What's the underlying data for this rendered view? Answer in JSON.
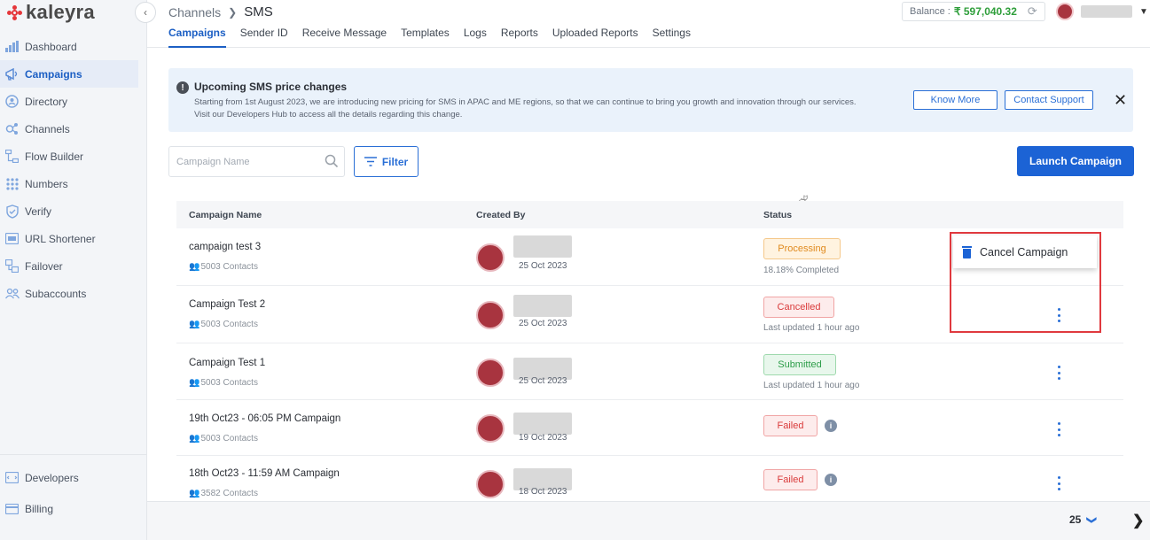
{
  "app": {
    "logo": "kaleyra"
  },
  "sidebar": {
    "items": [
      {
        "label": "Dashboard",
        "icon": "bar-chart-icon"
      },
      {
        "label": "Campaigns",
        "icon": "megaphone-icon",
        "active": true
      },
      {
        "label": "Directory",
        "icon": "contact-icon"
      },
      {
        "label": "Channels",
        "icon": "channels-icon"
      },
      {
        "label": "Flow Builder",
        "icon": "flow-icon"
      },
      {
        "label": "Numbers",
        "icon": "keypad-icon"
      },
      {
        "label": "Verify",
        "icon": "shield-icon"
      },
      {
        "label": "URL Shortener",
        "icon": "link-icon"
      },
      {
        "label": "Failover",
        "icon": "failover-icon"
      },
      {
        "label": "Subaccounts",
        "icon": "users-icon"
      }
    ],
    "bottom": [
      {
        "label": "Developers",
        "icon": "code-icon"
      },
      {
        "label": "Billing",
        "icon": "card-icon"
      }
    ]
  },
  "header": {
    "breadcrumb_parent": "Channels",
    "breadcrumb_current": "SMS",
    "tabs": [
      "Campaigns",
      "Sender ID",
      "Receive Message",
      "Templates",
      "Logs",
      "Reports",
      "Uploaded Reports",
      "Settings"
    ],
    "balance_label": "Balance :",
    "balance_amount": "₹ 597,040.32"
  },
  "banner": {
    "title": "Upcoming SMS price changes",
    "line1": "Starting from 1st August 2023, we are introducing new pricing for SMS in APAC and ME regions, so that we can continue to bring you growth and innovation through our services.",
    "line2": "Visit our Developers Hub to access all the details regarding this change.",
    "know_more": "Know More",
    "contact_support": "Contact Support"
  },
  "toolbar": {
    "search_placeholder": "Campaign Name",
    "filter_label": "Filter",
    "launch_label": "Launch Campaign"
  },
  "table": {
    "headers": {
      "name": "Campaign Name",
      "created_by": "Created By",
      "status": "Status"
    },
    "rows": [
      {
        "name": "campaign test 3",
        "contacts": "5003 Contacts",
        "date": "25 Oct 2023",
        "status": "Processing",
        "sub": "18.18% Completed"
      },
      {
        "name": "Campaign Test 2",
        "contacts": "5003 Contacts",
        "date": "25 Oct 2023",
        "status": "Cancelled",
        "sub": "Last updated 1 hour ago"
      },
      {
        "name": "Campaign Test 1",
        "contacts": "5003 Contacts",
        "date": "25 Oct 2023",
        "status": "Submitted",
        "sub": "Last updated 1 hour ago"
      },
      {
        "name": "19th Oct23 - 06:05 PM Campaign",
        "contacts": "5003 Contacts",
        "date": "19 Oct 2023",
        "status": "Failed",
        "sub": ""
      },
      {
        "name": "18th Oct23 - 11:59 AM Campaign",
        "contacts": "3582 Contacts",
        "date": "18 Oct 2023",
        "status": "Failed",
        "sub": ""
      }
    ]
  },
  "dropdown": {
    "cancel_label": "Cancel Campaign"
  },
  "footer": {
    "page_size": "25"
  },
  "colors": {
    "brand": "#e5363a",
    "accent": "#1c63d5",
    "highlight": "#e0393e"
  }
}
